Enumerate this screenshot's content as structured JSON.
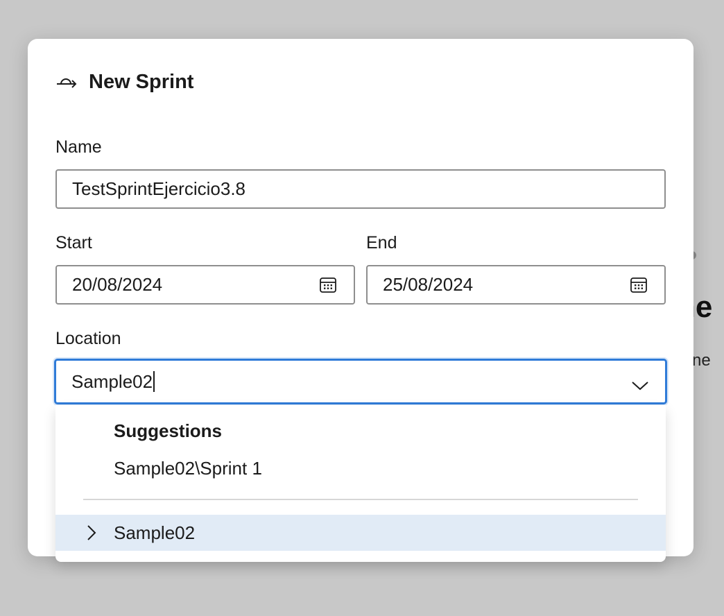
{
  "background": {
    "partial_heading": "ne",
    "partial_text": "e ne"
  },
  "dialog": {
    "title": "New Sprint",
    "title_icon": "sprint-icon",
    "name": {
      "label": "Name",
      "value": "TestSprintEjercicio3.8"
    },
    "start": {
      "label": "Start",
      "value": "20/08/2024",
      "icon": "calendar-icon"
    },
    "end": {
      "label": "End",
      "value": "25/08/2024",
      "icon": "calendar-icon"
    },
    "location": {
      "label": "Location",
      "value": "Sample02",
      "icon": "chevron-down-icon"
    }
  },
  "dropdown": {
    "suggestions_header": "Suggestions",
    "suggestions": [
      "Sample02\\Sprint 1"
    ],
    "tree_items": [
      {
        "label": "Sample02",
        "icon": "chevron-right-icon",
        "highlighted": true
      }
    ]
  },
  "colors": {
    "overlay": "#c8c8c8",
    "focus_border": "#2f7bd8",
    "highlight_row": "#e1ebf6",
    "field_border": "#8e8e8e"
  }
}
